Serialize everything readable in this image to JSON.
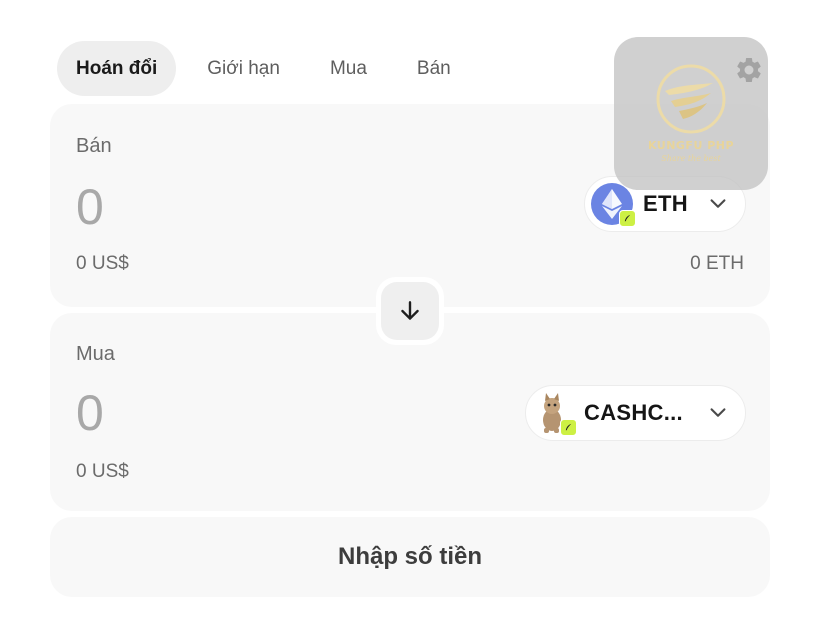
{
  "tabs": [
    {
      "label": "Hoán đổi",
      "active": true
    },
    {
      "label": "Giới hạn",
      "active": false
    },
    {
      "label": "Mua",
      "active": false
    },
    {
      "label": "Bán",
      "active": false
    }
  ],
  "sell": {
    "label": "Bán",
    "amount": "0",
    "usd_value": "0 US$",
    "token_symbol": "ETH",
    "token_icon": "ethereum-icon",
    "chain_badge_icon": "feather-icon",
    "balance": "0 ETH"
  },
  "buy": {
    "label": "Mua",
    "amount": "0",
    "usd_value": "0 US$",
    "token_symbol": "CASHC...",
    "token_icon": "cat-token-icon",
    "chain_badge_icon": "feather-icon"
  },
  "swap_direction_icon": "arrow-down-icon",
  "settings_icon": "gear-icon",
  "cta": {
    "label": "Nhập số tiền"
  },
  "watermark": {
    "name": "KUNGFU PHP",
    "slogan": "Share the best"
  },
  "colors": {
    "panel_bg": "#f8f8f8",
    "active_tab_bg": "#eeeeee",
    "eth_blue": "#6b84e3",
    "chain_badge": "#cdf044",
    "watermark_gold": "#e8d49a"
  }
}
